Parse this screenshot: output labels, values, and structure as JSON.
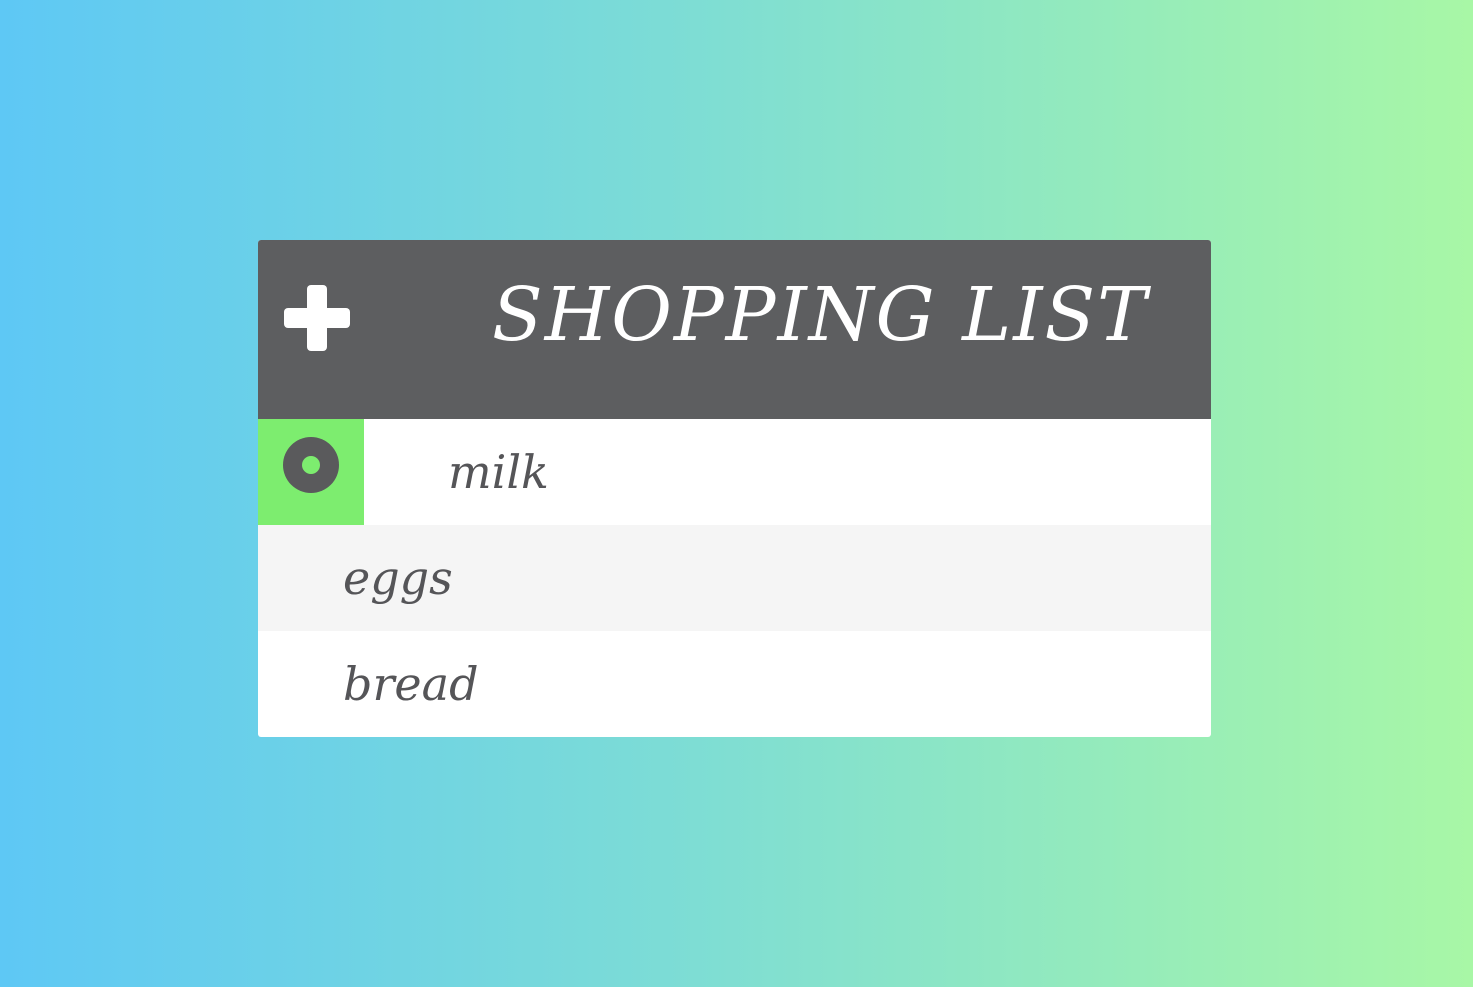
{
  "header": {
    "title": "SHOPPING LIST",
    "add_icon": "plus-icon"
  },
  "items": [
    {
      "label": "milk",
      "selected": true,
      "icon": "radio-selected-icon"
    },
    {
      "label": "eggs",
      "selected": false
    },
    {
      "label": "bread",
      "selected": false
    }
  ],
  "colors": {
    "header_bg": "#5d5e60",
    "accent_green": "#7ded6f",
    "text_dark": "#555558",
    "alt_row": "#f5f5f5",
    "gradient_start": "#5ec8f5",
    "gradient_end": "#a8f7a6"
  }
}
